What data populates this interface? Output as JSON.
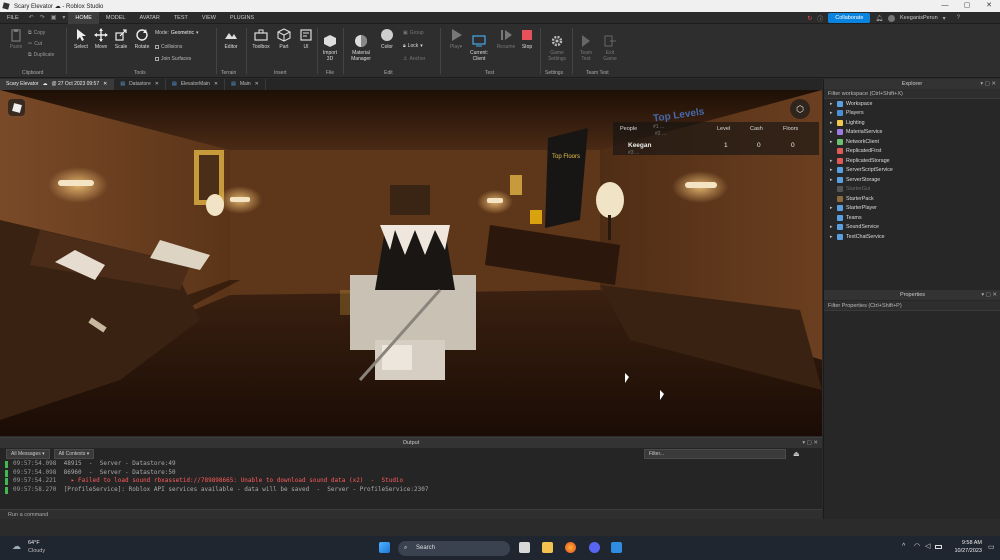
{
  "window": {
    "title_a": "Scary Elevator",
    "title_b": "- Roblox Studio",
    "controls": [
      "—",
      "▢",
      "✕"
    ]
  },
  "menu": {
    "items": [
      "FILE",
      "HOME",
      "MODEL",
      "AVATAR",
      "TEST",
      "VIEW",
      "PLUGINS"
    ],
    "active": "HOME",
    "collaborate": "Collaborate",
    "user": "KeeganisPerun"
  },
  "ribbon": {
    "paste": "Paste",
    "copy": "Copy",
    "cut": "Cut",
    "duplicate": "Duplicate",
    "clipboard": "Clipboard",
    "select": "Select",
    "move": "Move",
    "scale": "Scale",
    "rotate": "Rotate",
    "mode_label": "Mode:",
    "mode_value": "Geometric",
    "collisions": "Collisions",
    "join_surfaces": "Join Surfaces",
    "tools": "Tools",
    "editor": "Editor",
    "terrain": "Terrain",
    "toolbox": "Toolbox",
    "part": "Part",
    "ui": "UI",
    "insert": "Insert",
    "import3d": "Import\n3D",
    "file": "File",
    "material_manager": "Material\nManager",
    "color": "Color",
    "group": "Group",
    "lock": "Lock",
    "anchor": "Anchor",
    "edit": "Edit",
    "play": "Play",
    "current_client": "Current:\nClient",
    "resume": "Resume",
    "stop": "Stop",
    "test": "Test",
    "game_settings": "Game\nSettings",
    "settings": "Settings",
    "team_test": "Team\nTest",
    "exit_game": "Exit\nGame",
    "team_test_group": "Team Test"
  },
  "tabs": [
    {
      "label": "Scary Elevator",
      "extra": "@ 27 Oct 2023 09:57"
    },
    {
      "label": "Datastore"
    },
    {
      "label": "ElevatorMain"
    },
    {
      "label": "Main"
    }
  ],
  "leaderboard": {
    "headers": [
      "People",
      "Level",
      "Cash",
      "Floors"
    ],
    "row": {
      "name": "Keegan",
      "level": "1",
      "cash": "0",
      "floors": "0"
    }
  },
  "scene": {
    "sign_title": "Top Levels",
    "sign_lines": [
      "#1 ...",
      "#2 ...",
      "#3 ..."
    ],
    "sign2": "Top Floors"
  },
  "output": {
    "title": "Output",
    "messages_filter": "All Messages",
    "contexts_filter": "All Contexts",
    "filter_placeholder": "Filter...",
    "lines": [
      {
        "time": "09:57:54.098",
        "text": "48915  -  Server - Datastore:49",
        "type": "info"
      },
      {
        "time": "09:57:54.098",
        "text": "86960  -  Server - Datastore:50",
        "type": "info"
      },
      {
        "time": "09:57:54.221",
        "text": "  ▸ Failed to load sound rbxassetid://789898665: Unable to download sound data (x2)  -  Studio",
        "type": "err"
      },
      {
        "time": "09:57:58.270",
        "text": "[ProfileService]: Roblox API services available - data will be saved  -  Server - ProfileService:2307",
        "type": "info"
      }
    ],
    "command_placeholder": "Run a command"
  },
  "explorer": {
    "title": "Explorer",
    "filter": "Filter workspace (Ctrl+Shift+X)",
    "items": [
      {
        "label": "Workspace",
        "color": "#5aa0e0",
        "exp": true
      },
      {
        "label": "Players",
        "color": "#4a90d9",
        "exp": true
      },
      {
        "label": "Lighting",
        "color": "#f2c94c",
        "exp": true
      },
      {
        "label": "MaterialService",
        "color": "#9c7ce0",
        "exp": true
      },
      {
        "label": "NetworkClient",
        "color": "#6fbf73",
        "exp": true
      },
      {
        "label": "ReplicatedFirst",
        "color": "#e05a5a",
        "exp": false
      },
      {
        "label": "ReplicatedStorage",
        "color": "#e05a5a",
        "exp": true
      },
      {
        "label": "ServerScriptService",
        "color": "#5aa0e0",
        "exp": true
      },
      {
        "label": "ServerStorage",
        "color": "#5aa0e0",
        "exp": true
      },
      {
        "label": "StarterGui",
        "color": "#555555",
        "exp": false,
        "dim": true
      },
      {
        "label": "StarterPack",
        "color": "#8b6a3e",
        "exp": false
      },
      {
        "label": "StarterPlayer",
        "color": "#5aa0e0",
        "exp": true
      },
      {
        "label": "Teams",
        "color": "#5aa0e0",
        "exp": false
      },
      {
        "label": "SoundService",
        "color": "#5aa0e0",
        "exp": true
      },
      {
        "label": "TextChatService",
        "color": "#5aa0e0",
        "exp": true
      }
    ]
  },
  "properties": {
    "title": "Properties",
    "filter": "Filter Properties (Ctrl+Shift+P)"
  },
  "taskbar": {
    "weather_temp": "64°F",
    "weather_desc": "Cloudy",
    "search": "Search",
    "time": "9:58 AM",
    "date": "10/27/2023"
  },
  "colors": {
    "accent": "#0b84e0",
    "error": "#ff5a5a",
    "ok": "#3fb950"
  }
}
